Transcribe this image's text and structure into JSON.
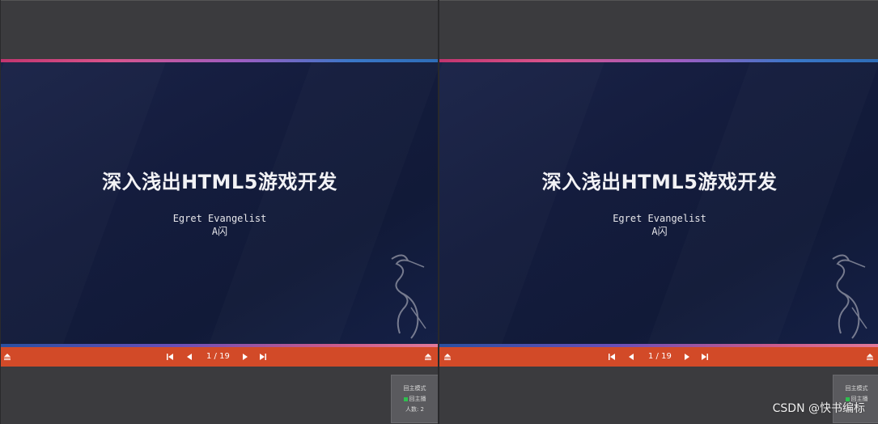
{
  "slide": {
    "title": "深入浅出HTML5游戏开发",
    "subtitle_line1": "Egret Evangelist",
    "subtitle_line2": "A闪"
  },
  "navbar": {
    "page_indicator": "1 / 19"
  },
  "presenter_panel": {
    "mode_label": "回主模式",
    "status_label": "回主播",
    "audience_label": "人数: 2",
    "status_color": "#2fbf4f"
  },
  "watermark": "CSDN @快书编标",
  "colors": {
    "navbar": "#d24a28",
    "slide_bg": "#141c3d",
    "background": "#3b3b3e"
  },
  "icons": [
    "first-page-icon",
    "prev-page-icon",
    "next-page-icon",
    "last-page-icon",
    "menu-icon",
    "egret-logo-icon"
  ]
}
